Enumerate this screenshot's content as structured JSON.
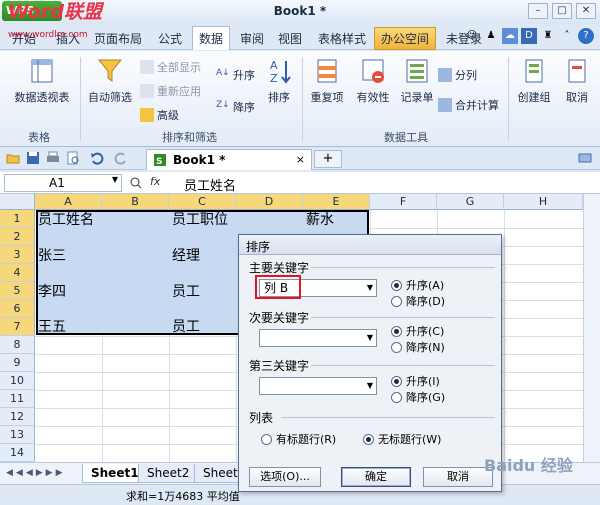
{
  "titlebar": {
    "app_button": "WPS",
    "watermark": "Word联盟",
    "title": "Book1 *",
    "controls": [
      "–",
      "□",
      "✕"
    ]
  },
  "menu": {
    "items": [
      "开始",
      "插入",
      "页面布局",
      "公式",
      "数据",
      "审阅",
      "视图",
      "表格样式",
      "办公空间",
      "未登录"
    ],
    "active": "数据",
    "watermark_url": "www.wordlm.com"
  },
  "ribbon": {
    "pivot": "数据透视表",
    "group_table": "表格",
    "autofilter": "自动筛选",
    "show_all": "全部显示",
    "reapply": "重新应用",
    "advanced": "高级",
    "asc": "升序",
    "desc": "降序",
    "sort": "排序",
    "group_sort_filter": "排序和筛选",
    "dup": "重复项",
    "validity": "有效性",
    "record": "记录单",
    "split": "分列",
    "merge_calc": "合并计算",
    "group_data_tools": "数据工具",
    "create_group": "创建组",
    "ungroup": "取消"
  },
  "doctab": {
    "name": "Book1 *",
    "close": "×",
    "add": "+"
  },
  "formula": {
    "namebox": "A1",
    "fx": "fx",
    "value": "员工姓名"
  },
  "grid": {
    "columns": [
      "A",
      "B",
      "C",
      "D",
      "E",
      "F",
      "G",
      "H"
    ],
    "rows": [
      "1",
      "2",
      "3",
      "4",
      "5",
      "6",
      "7",
      "8",
      "9",
      "10",
      "11",
      "12",
      "13",
      "14"
    ],
    "cells": {
      "a1": "员工姓名",
      "c1": "员工职位",
      "e1": "薪水",
      "a3": "张三",
      "c3": "经理",
      "a5": "李四",
      "c5": "员工",
      "a7": "王五",
      "c7": "员工"
    }
  },
  "sheets": [
    "Sheet1",
    "Sheet2",
    "Sheet3"
  ],
  "status": {
    "text": "求和=1万4683  平均值"
  },
  "dialog": {
    "title": "排序",
    "primary_label": "主要关键字",
    "primary_value": "列 B",
    "secondary_label": "次要关键字",
    "tertiary_label": "第三关键字",
    "asc_a": "升序(A)",
    "desc_d": "降序(D)",
    "asc_c": "升序(C)",
    "desc_n": "降序(N)",
    "asc_i": "升序(I)",
    "desc_g": "降序(G)",
    "list_label": "列表",
    "has_header": "有标题行(R)",
    "no_header": "无标题行(W)",
    "options": "选项(O)...",
    "ok": "确定",
    "cancel": "取消"
  },
  "watermark_baidu": "Baidu 经验",
  "colors": {
    "accent": "#2e8a21",
    "selection": "#c7daf2",
    "highlight": "#e4151f",
    "header_sel": "#f6d77a"
  }
}
